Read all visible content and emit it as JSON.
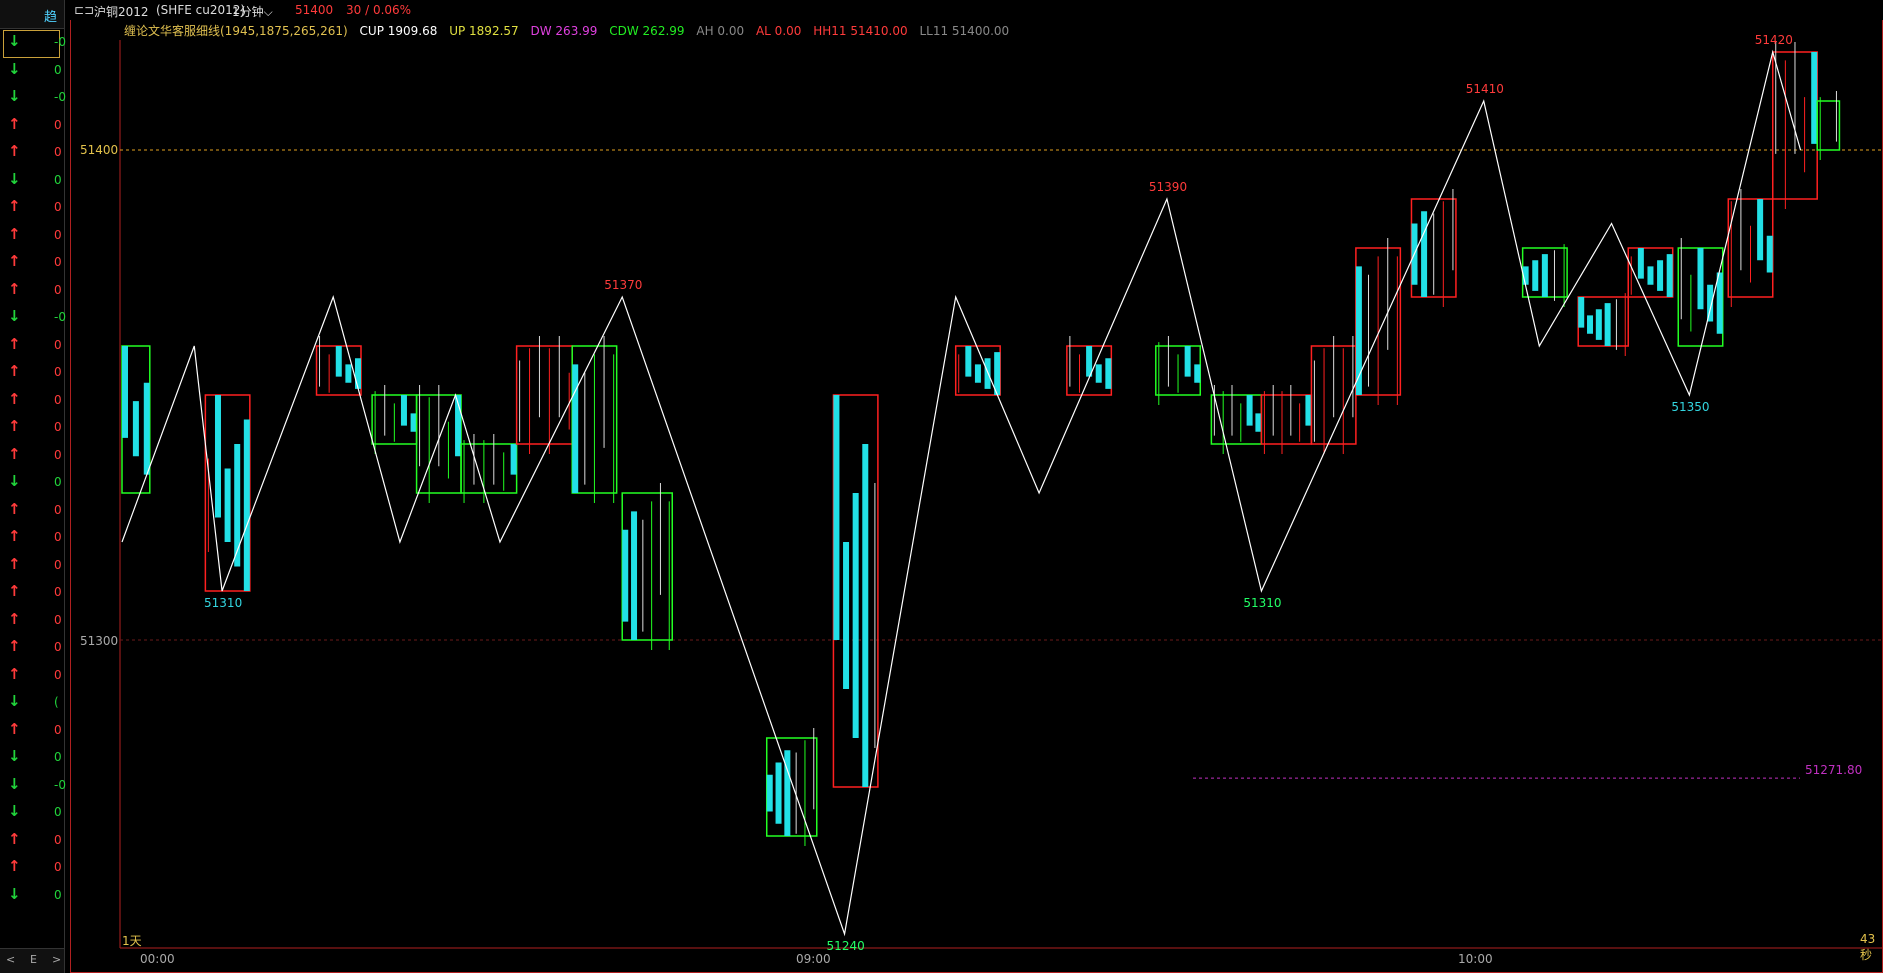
{
  "left_panel": {
    "header_label": "趋",
    "rows": [
      {
        "dir": "down",
        "digit": "-0"
      },
      {
        "dir": "down",
        "digit": "0"
      },
      {
        "dir": "down",
        "digit": "-0"
      },
      {
        "dir": "up",
        "digit": "0"
      },
      {
        "dir": "up",
        "digit": "0"
      },
      {
        "dir": "down",
        "digit": "0"
      },
      {
        "dir": "up",
        "digit": "0"
      },
      {
        "dir": "up",
        "digit": "0"
      },
      {
        "dir": "up",
        "digit": "0"
      },
      {
        "dir": "up",
        "digit": "0"
      },
      {
        "dir": "down",
        "digit": "-0"
      },
      {
        "dir": "up",
        "digit": "0"
      },
      {
        "dir": "up",
        "digit": "0"
      },
      {
        "dir": "up",
        "digit": "0"
      },
      {
        "dir": "up",
        "digit": "0"
      },
      {
        "dir": "up",
        "digit": "0"
      },
      {
        "dir": "down",
        "digit": "0"
      },
      {
        "dir": "up",
        "digit": "0"
      },
      {
        "dir": "up",
        "digit": "0"
      },
      {
        "dir": "up",
        "digit": "0"
      },
      {
        "dir": "up",
        "digit": "0"
      },
      {
        "dir": "up",
        "digit": "0"
      },
      {
        "dir": "up",
        "digit": "0"
      },
      {
        "dir": "up",
        "digit": "0"
      },
      {
        "dir": "down",
        "digit": "("
      },
      {
        "dir": "up",
        "digit": "0"
      },
      {
        "dir": "down",
        "digit": "0"
      },
      {
        "dir": "down",
        "digit": "-0"
      },
      {
        "dir": "down",
        "digit": "0"
      },
      {
        "dir": "up",
        "digit": "0"
      },
      {
        "dir": "up",
        "digit": "0"
      },
      {
        "dir": "down",
        "digit": "0"
      }
    ],
    "footer": [
      "<",
      "E",
      ">"
    ]
  },
  "top_bar": {
    "window_icon": "⊏⊐",
    "symbol": "沪铜2012",
    "exchange": "(SHFE cu2012)",
    "period": "1分钟",
    "last_price": "51400",
    "change": "30 / 0.06%"
  },
  "indicator": {
    "name": "缠论文华客服细线(1945,1875,265,261)",
    "cup": "CUP 1909.68",
    "up": "UP 1892.57",
    "dw": "DW 263.99",
    "cdw": "CDW 262.99",
    "ah": "AH 0.00",
    "al": "AL 0.00",
    "hh": "HH11 51410.00",
    "ll": "LL11 51400.00"
  },
  "price_axis": {
    "ticks": [
      {
        "label": "51400",
        "price": 51400
      },
      {
        "label": "51300",
        "price": 51300
      }
    ]
  },
  "bottom_axis": {
    "times": [
      "00:00",
      "09:00",
      "10:00"
    ],
    "left_label": "1天",
    "right_label": "43秒"
  },
  "colors": {
    "up_box": "#ff2020",
    "down_box": "#22ff22",
    "bar_fill": "#22e0e6",
    "zigzag": "#ffffff",
    "ref_line": "#e0a020",
    "avg_line": "#c030c0",
    "red_label": "#ff3b3b",
    "cyan_label": "#33d6e0",
    "green_label": "#22ff66"
  },
  "chart_data": {
    "type": "line",
    "title": "沪铜2012 1分钟",
    "xlabel": "",
    "ylabel": "",
    "ylim": [
      51230,
      51430
    ],
    "zigzag": [
      {
        "x": 0,
        "y": 51320
      },
      {
        "x": 13,
        "y": 51360
      },
      {
        "x": 18,
        "y": 51310
      },
      {
        "x": 38,
        "y": 51370
      },
      {
        "x": 50,
        "y": 51320
      },
      {
        "x": 60,
        "y": 51350
      },
      {
        "x": 68,
        "y": 51320
      },
      {
        "x": 90,
        "y": 51370
      },
      {
        "x": 130,
        "y": 51240
      },
      {
        "x": 150,
        "y": 51370
      },
      {
        "x": 165,
        "y": 51330
      },
      {
        "x": 188,
        "y": 51390
      },
      {
        "x": 205,
        "y": 51310
      },
      {
        "x": 245,
        "y": 51410
      },
      {
        "x": 255,
        "y": 51360
      },
      {
        "x": 268,
        "y": 51385
      },
      {
        "x": 282,
        "y": 51350
      },
      {
        "x": 297,
        "y": 51420
      },
      {
        "x": 302,
        "y": 51400
      }
    ],
    "pivot_labels": [
      {
        "text": "51310",
        "x": 18,
        "y": 51310,
        "kind": "low-cyan"
      },
      {
        "text": "51370",
        "x": 90,
        "y": 51370,
        "kind": "high"
      },
      {
        "text": "51240",
        "x": 130,
        "y": 51240,
        "kind": "low-green"
      },
      {
        "text": "51390",
        "x": 188,
        "y": 51390,
        "kind": "high"
      },
      {
        "text": "51310",
        "x": 205,
        "y": 51310,
        "kind": "low-green"
      },
      {
        "text": "51410",
        "x": 245,
        "y": 51410,
        "kind": "high"
      },
      {
        "text": "51350",
        "x": 282,
        "y": 51350,
        "kind": "low-cyan"
      },
      {
        "text": "51420",
        "x": 297,
        "y": 51420,
        "kind": "high"
      }
    ],
    "boxes": [
      {
        "x0": 0,
        "x1": 5,
        "y0": 51330,
        "y1": 51360,
        "dir": "down"
      },
      {
        "x0": 15,
        "x1": 23,
        "y0": 51310,
        "y1": 51350,
        "dir": "up"
      },
      {
        "x0": 35,
        "x1": 43,
        "y0": 51350,
        "y1": 51360,
        "dir": "up"
      },
      {
        "x0": 45,
        "x1": 53,
        "y0": 51340,
        "y1": 51350,
        "dir": "down"
      },
      {
        "x0": 53,
        "x1": 61,
        "y0": 51330,
        "y1": 51350,
        "dir": "down"
      },
      {
        "x0": 61,
        "x1": 71,
        "y0": 51330,
        "y1": 51340,
        "dir": "down"
      },
      {
        "x0": 71,
        "x1": 81,
        "y0": 51340,
        "y1": 51360,
        "dir": "up"
      },
      {
        "x0": 81,
        "x1": 89,
        "y0": 51330,
        "y1": 51360,
        "dir": "down"
      },
      {
        "x0": 90,
        "x1": 99,
        "y0": 51300,
        "y1": 51330,
        "dir": "down"
      },
      {
        "x0": 116,
        "x1": 125,
        "y0": 51260,
        "y1": 51280,
        "dir": "down"
      },
      {
        "x0": 128,
        "x1": 136,
        "y0": 51270,
        "y1": 51350,
        "dir": "up"
      },
      {
        "x0": 150,
        "x1": 158,
        "y0": 51350,
        "y1": 51360,
        "dir": "up"
      },
      {
        "x0": 170,
        "x1": 178,
        "y0": 51350,
        "y1": 51360,
        "dir": "up"
      },
      {
        "x0": 186,
        "x1": 194,
        "y0": 51350,
        "y1": 51360,
        "dir": "down"
      },
      {
        "x0": 196,
        "x1": 205,
        "y0": 51340,
        "y1": 51350,
        "dir": "down"
      },
      {
        "x0": 205,
        "x1": 214,
        "y0": 51340,
        "y1": 51350,
        "dir": "up"
      },
      {
        "x0": 214,
        "x1": 222,
        "y0": 51340,
        "y1": 51360,
        "dir": "up"
      },
      {
        "x0": 222,
        "x1": 230,
        "y0": 51350,
        "y1": 51380,
        "dir": "up"
      },
      {
        "x0": 232,
        "x1": 240,
        "y0": 51370,
        "y1": 51390,
        "dir": "up"
      },
      {
        "x0": 252,
        "x1": 260,
        "y0": 51370,
        "y1": 51380,
        "dir": "down"
      },
      {
        "x0": 262,
        "x1": 271,
        "y0": 51360,
        "y1": 51370,
        "dir": "up"
      },
      {
        "x0": 271,
        "x1": 279,
        "y0": 51370,
        "y1": 51380,
        "dir": "up"
      },
      {
        "x0": 280,
        "x1": 288,
        "y0": 51360,
        "y1": 51380,
        "dir": "down"
      },
      {
        "x0": 289,
        "x1": 297,
        "y0": 51370,
        "y1": 51390,
        "dir": "up"
      },
      {
        "x0": 297,
        "x1": 305,
        "y0": 51390,
        "y1": 51420,
        "dir": "up"
      },
      {
        "x0": 305,
        "x1": 309,
        "y0": 51400,
        "y1": 51410,
        "dir": "down"
      }
    ],
    "ref_price": 51400,
    "avg_price": 51271.8,
    "avg_label": "51271.80"
  }
}
